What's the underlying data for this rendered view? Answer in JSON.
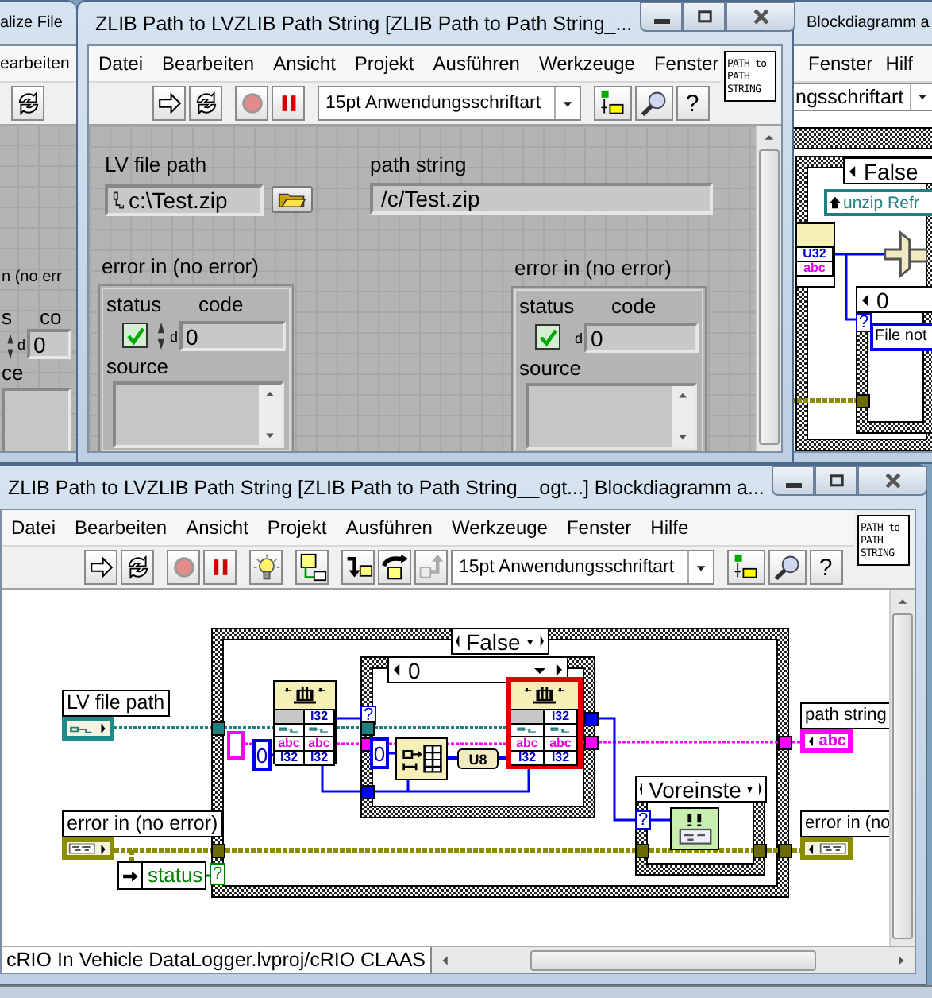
{
  "left_back_window": {
    "title": "alize File",
    "menu": [
      "earbeiten"
    ],
    "cluster_label": "n (no err",
    "status_label": "s",
    "code_label": "co",
    "code_radix": "d",
    "code_value": "0",
    "source_label": "ce"
  },
  "right_back_window": {
    "title": "Blockdiagramm a",
    "menu": [
      "Fenster",
      "Hilf"
    ],
    "font": "ngsschriftart",
    "case_selector": "False",
    "property_node": "unzip Refr",
    "node_rows": [
      "U32",
      "abc"
    ],
    "inner_selector": "0",
    "tunnel": "?",
    "string_constant": "File not"
  },
  "front_panel": {
    "title": "ZLIB Path to LVZLIB Path String [ZLIB Path to Path String_...",
    "menu": [
      "Datei",
      "Bearbeiten",
      "Ansicht",
      "Projekt",
      "Ausführen",
      "Werkzeuge",
      "Fenster"
    ],
    "font": "15pt Anwendungsschriftart",
    "help": "?",
    "vi_icon": [
      "PATH to",
      "PATH",
      "STRING"
    ],
    "path_control": {
      "label": "LV file path",
      "value": "c:\\Test.zip"
    },
    "string_indicator": {
      "label": "path string",
      "value": "/c/Test.zip"
    },
    "clusters": [
      {
        "kind": "control",
        "label": "error in (no error)",
        "status_label": "status",
        "code_label": "code",
        "status_checked": true,
        "code_radix": "d",
        "code_value": "0",
        "source_label": "source"
      },
      {
        "kind": "indicator",
        "label": "error in (no error)",
        "status_label": "status",
        "code_label": "code",
        "status_checked": true,
        "code_radix": "d",
        "code_value": "0",
        "source_label": "source"
      }
    ]
  },
  "block_diagram": {
    "title": "ZLIB Path to LVZLIB Path String [ZLIB Path to Path String__ogt...] Blockdiagramm a...",
    "menu": [
      "Datei",
      "Bearbeiten",
      "Ansicht",
      "Projekt",
      "Ausführen",
      "Werkzeuge",
      "Fenster",
      "Hilfe"
    ],
    "font": "15pt Anwendungsschriftart",
    "help": "?",
    "vi_icon": [
      "PATH to",
      "PATH",
      "STRING"
    ],
    "terminals": [
      {
        "kind": "path_control",
        "label": "LV file path"
      },
      {
        "kind": "error_control",
        "label": "error in (no error)"
      },
      {
        "kind": "string_indicator",
        "label": "path string",
        "type_text": "abc"
      },
      {
        "kind": "error_indicator",
        "label": "error in (no"
      }
    ],
    "unbundle_element": "status",
    "case_selectors": [
      "False",
      "0",
      "Voreinste"
    ],
    "selector_terminals": [
      "?",
      "?",
      "?"
    ],
    "bundle_nodes": [
      {
        "breakpoint": false,
        "rows": [
          {
            "kind": "numeric",
            "output": "I32"
          },
          {
            "kind": "path"
          },
          {
            "kind": "string",
            "input": "abc",
            "output": "abc"
          },
          {
            "kind": "numeric",
            "input": "I32",
            "output": "I32"
          }
        ]
      },
      {
        "breakpoint": true,
        "rows": [
          {
            "kind": "numeric",
            "output": "I32"
          },
          {
            "kind": "path"
          },
          {
            "kind": "string",
            "input": "abc",
            "output": "abc"
          },
          {
            "kind": "numeric",
            "input": "I32",
            "output": "I32"
          }
        ]
      }
    ],
    "constants": [
      {
        "kind": "numeric",
        "value": "0"
      },
      {
        "kind": "numeric",
        "value": "0"
      },
      {
        "kind": "array",
        "value": "U8"
      }
    ],
    "status_bar": "cRIO In Vehicle DataLogger.lvproj/cRIO CLAAS"
  }
}
